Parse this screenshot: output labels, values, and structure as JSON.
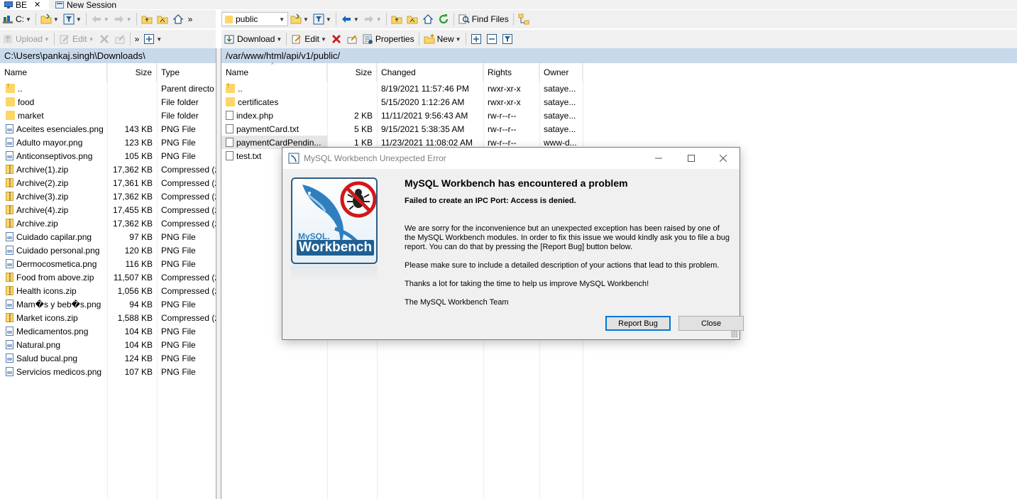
{
  "tabs": [
    {
      "label": "BE",
      "close": "✕"
    },
    {
      "label": "New Session"
    }
  ],
  "left_toolbar": {
    "drive": "C:",
    "more": "»",
    "upload": "Upload",
    "edit": "Edit",
    "more2": "»"
  },
  "right_toolbar": {
    "folder": "public",
    "find_files": "Find Files",
    "download": "Download",
    "edit": "Edit",
    "properties": "Properties",
    "new": "New"
  },
  "left_path": "C:\\Users\\pankaj.singh\\Downloads\\",
  "right_path": "/var/www/html/api/v1/public/",
  "left_columns": {
    "name": "Name",
    "size": "Size",
    "type": "Type"
  },
  "right_columns": {
    "name": "Name",
    "size": "Size",
    "changed": "Changed",
    "rights": "Rights",
    "owner": "Owner"
  },
  "left_files": [
    {
      "icon": "folder-up",
      "name": "..",
      "size": "",
      "type": "Parent directo"
    },
    {
      "icon": "folder",
      "name": "food",
      "size": "",
      "type": "File folder"
    },
    {
      "icon": "folder",
      "name": "market",
      "size": "",
      "type": "File folder"
    },
    {
      "icon": "image",
      "name": "Aceites esenciales.png",
      "size": "143 KB",
      "type": "PNG File"
    },
    {
      "icon": "image",
      "name": "Adulto mayor.png",
      "size": "123 KB",
      "type": "PNG File"
    },
    {
      "icon": "image",
      "name": "Anticonseptivos.png",
      "size": "105 KB",
      "type": "PNG File"
    },
    {
      "icon": "zip",
      "name": "Archive(1).zip",
      "size": "17,362 KB",
      "type": "Compressed (z"
    },
    {
      "icon": "zip",
      "name": "Archive(2).zip",
      "size": "17,361 KB",
      "type": "Compressed (z"
    },
    {
      "icon": "zip",
      "name": "Archive(3).zip",
      "size": "17,362 KB",
      "type": "Compressed (z"
    },
    {
      "icon": "zip",
      "name": "Archive(4).zip",
      "size": "17,455 KB",
      "type": "Compressed (z"
    },
    {
      "icon": "zip",
      "name": "Archive.zip",
      "size": "17,362 KB",
      "type": "Compressed (z"
    },
    {
      "icon": "image",
      "name": "Cuidado capilar.png",
      "size": "97 KB",
      "type": "PNG File"
    },
    {
      "icon": "image",
      "name": "Cuidado personal.png",
      "size": "120 KB",
      "type": "PNG File"
    },
    {
      "icon": "image",
      "name": "Dermocosmetica.png",
      "size": "116 KB",
      "type": "PNG File"
    },
    {
      "icon": "zip",
      "name": "Food from above.zip",
      "size": "11,507 KB",
      "type": "Compressed (z"
    },
    {
      "icon": "zip",
      "name": "Health icons.zip",
      "size": "1,056 KB",
      "type": "Compressed (z"
    },
    {
      "icon": "image",
      "name": "Mam�s y beb�s.png",
      "size": "94 KB",
      "type": "PNG File"
    },
    {
      "icon": "zip",
      "name": "Market icons.zip",
      "size": "1,588 KB",
      "type": "Compressed (z"
    },
    {
      "icon": "image",
      "name": "Medicamentos.png",
      "size": "104 KB",
      "type": "PNG File"
    },
    {
      "icon": "image",
      "name": "Natural.png",
      "size": "104 KB",
      "type": "PNG File"
    },
    {
      "icon": "image",
      "name": "Salud bucal.png",
      "size": "124 KB",
      "type": "PNG File"
    },
    {
      "icon": "image",
      "name": "Servicios medicos.png",
      "size": "107 KB",
      "type": "PNG File"
    }
  ],
  "right_files": [
    {
      "icon": "folder-up",
      "name": "..",
      "size": "",
      "changed": "8/19/2021 11:57:46 PM",
      "rights": "rwxr-xr-x",
      "owner": "sataye..."
    },
    {
      "icon": "folder",
      "name": "certificates",
      "size": "",
      "changed": "5/15/2020 1:12:26 AM",
      "rights": "rwxr-xr-x",
      "owner": "sataye..."
    },
    {
      "icon": "doc",
      "name": "index.php",
      "size": "2 KB",
      "changed": "11/11/2021 9:56:43 AM",
      "rights": "rw-r--r--",
      "owner": "sataye..."
    },
    {
      "icon": "doc",
      "name": "paymentCard.txt",
      "size": "5 KB",
      "changed": "9/15/2021 5:38:35 AM",
      "rights": "rw-r--r--",
      "owner": "sataye..."
    },
    {
      "icon": "doc",
      "name": "paymentCardPendin...",
      "size": "1 KB",
      "changed": "11/23/2021 11:08:02 AM",
      "rights": "rw-r--r--",
      "owner": "www-d..."
    },
    {
      "icon": "doc",
      "name": "test.txt",
      "size": "",
      "changed": "",
      "rights": "",
      "owner": ""
    }
  ],
  "dialog": {
    "title": "MySQL Workbench Unexpected Error",
    "logo_text_top": "MySQL.",
    "logo_text_bottom": "Workbench",
    "heading": "MySQL Workbench has encountered a problem",
    "subheading": "Failed to create an IPC Port: Access is denied.",
    "paragraph1": "We are sorry for the inconvenience but an unexpected exception has been raised by one of the MySQL Workbench modules. In order to fix this issue we would kindly ask you to file a bug report. You can do that by pressing the [Report Bug] button below.",
    "paragraph2": "Please make sure to include a detailed description of your actions that lead to this problem.",
    "paragraph3": "Thanks a lot for taking the time to help us improve MySQL Workbench!",
    "signature": "The MySQL Workbench Team",
    "report_bug": "Report Bug",
    "close": "Close"
  },
  "colors": {
    "accent": "#0078d7",
    "path_bar": "#c9d9ec",
    "folder": "#fcd667"
  }
}
